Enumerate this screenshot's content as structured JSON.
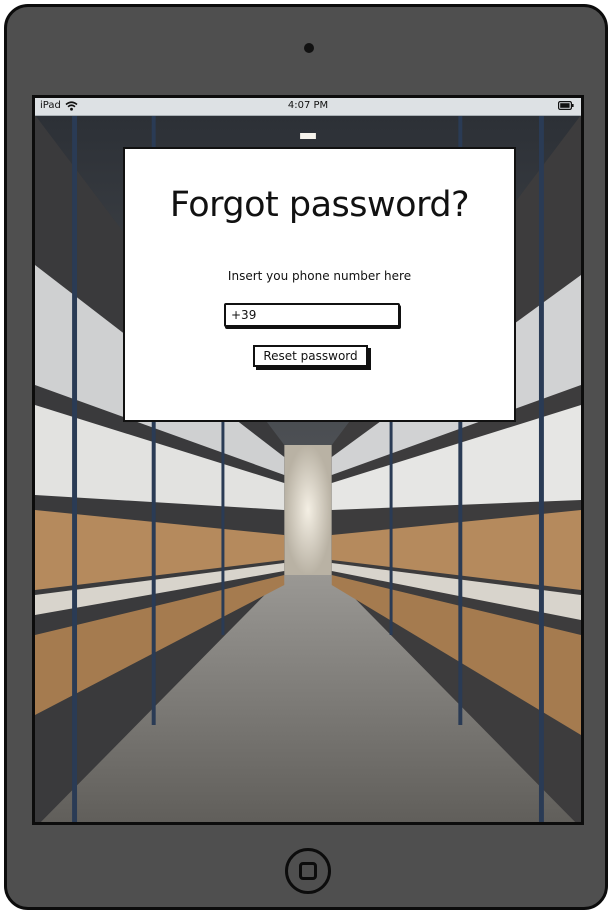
{
  "device": {
    "type": "tablet",
    "status_bar": {
      "carrier": "iPad",
      "time": "4:07 PM",
      "wifi_icon": "wifi-icon",
      "battery_icon": "battery-icon"
    }
  },
  "background": {
    "subject": "warehouse aisle with shelving and boxes"
  },
  "dialog": {
    "title": "Forgot password?",
    "label": "Insert you phone number here",
    "phone_value": "+39",
    "reset_button_label": "Reset password"
  },
  "colors": {
    "frame": "#4f4f4f",
    "outline": "#0c0c0c",
    "status_bar": "#dde1e4",
    "dialog_bg": "#ffffff"
  }
}
